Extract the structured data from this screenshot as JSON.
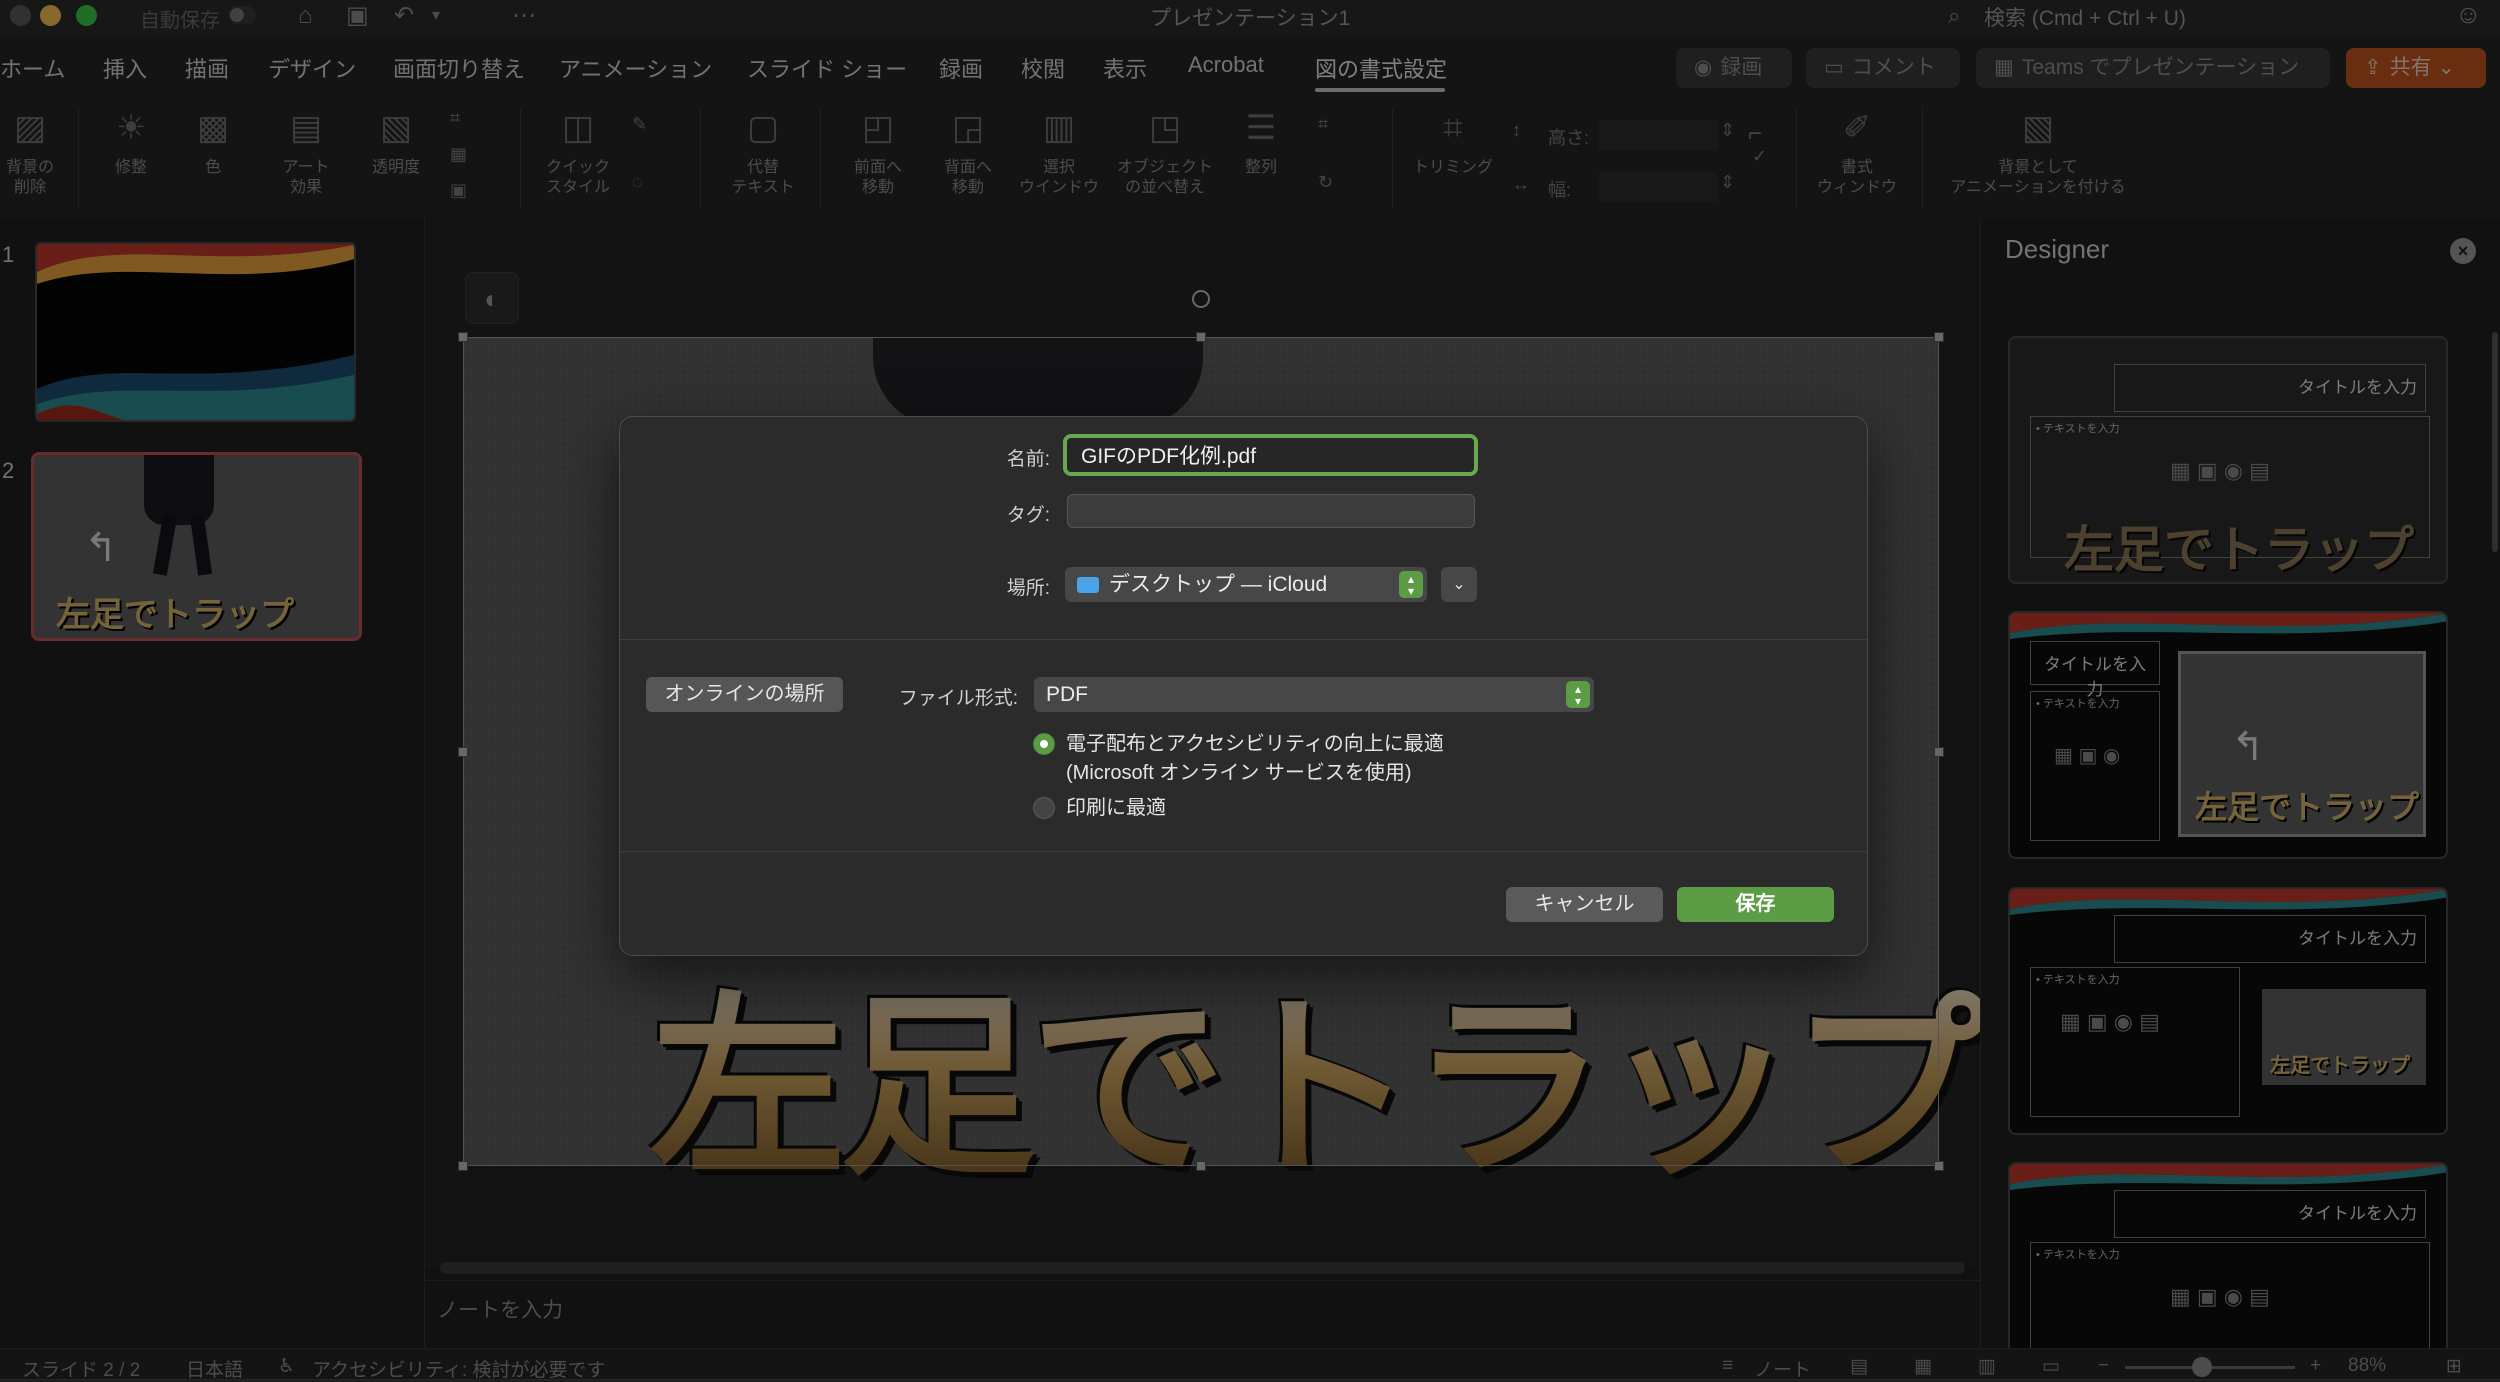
{
  "titlebar": {
    "autosave_label": "自動保存",
    "document_title": "プレゼンテーション1",
    "search_placeholder": "検索 (Cmd + Ctrl + U)"
  },
  "ribbon": {
    "tabs": [
      {
        "label": "ホーム"
      },
      {
        "label": "挿入"
      },
      {
        "label": "描画"
      },
      {
        "label": "デザイン"
      },
      {
        "label": "画面切り替え"
      },
      {
        "label": "アニメーション"
      },
      {
        "label": "スライド ショー"
      },
      {
        "label": "録画"
      },
      {
        "label": "校閲"
      },
      {
        "label": "表示"
      },
      {
        "label": "Acrobat"
      },
      {
        "label": "図の書式設定"
      }
    ],
    "active_tab": "図の書式設定",
    "record_button": "録画",
    "comment_button": "コメント",
    "teams_button": "Teams でプレゼンテーション",
    "share_button": "共有",
    "tools": {
      "remove_background": "背景の\n削除",
      "corrections": "修整",
      "color": "色",
      "artistic_effects": "アート\n効果",
      "transparency": "透明度",
      "quick_styles": "クイック\nスタイル",
      "alt_text": "代替\nテキスト",
      "bring_forward": "前面へ\n移動",
      "send_backward": "背面へ\n移動",
      "selection_pane": "選択\nウインドウ",
      "reorder_objects": "オブジェクト\nの並べ替え",
      "align": "整列",
      "crop": "トリミング",
      "height_label": "高さ:",
      "width_label": "幅:",
      "format_pane": "書式\nウィンドウ",
      "animate_as_background": "背景として\nアニメーションを付ける"
    }
  },
  "thumbnails": {
    "slide1_number": "1",
    "slide2_number": "2",
    "slide2_caption": "左足でトラップ"
  },
  "slide": {
    "title_art": "左足でトラップ"
  },
  "notes": {
    "placeholder": "ノートを入力"
  },
  "save_dialog": {
    "name_label": "名前:",
    "name_value": "GIFのPDF化例.pdf",
    "tag_label": "タグ:",
    "location_label": "場所:",
    "location_value": "デスクトップ — iCloud",
    "online_locations_button": "オンラインの場所",
    "file_format_label": "ファイル形式:",
    "file_format_value": "PDF",
    "option_distribution_line1": "電子配布とアクセシビリティの向上に最適",
    "option_distribution_line2": "(Microsoft オンライン サービスを使用)",
    "option_print": "印刷に最適",
    "selected_option": "distribution",
    "cancel_button": "キャンセル",
    "save_button": "保存"
  },
  "designer": {
    "title": "Designer",
    "card_title_placeholder": "タイトルを入力",
    "card_text_placeholder": "• テキストを入力",
    "card_caption": "左足でトラップ"
  },
  "statusbar": {
    "slide_indicator": "スライド 2 / 2",
    "language": "日本語",
    "accessibility": "アクセシビリティ: 検討が必要です",
    "notes_button": "ノート",
    "zoom": "88%"
  },
  "colors": {
    "accent_green": "#5c9c44",
    "share_orange": "#c0541d",
    "selection_red": "#c0504d"
  }
}
